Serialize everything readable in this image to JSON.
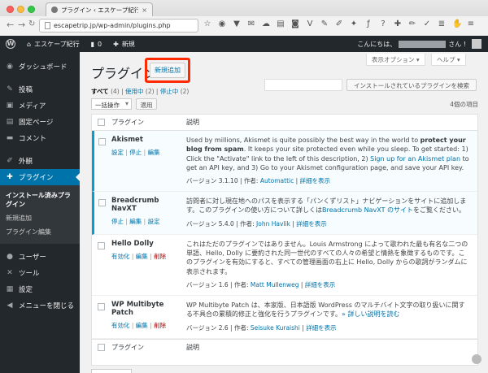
{
  "browser": {
    "tab_title": "プラグイン ‹ エスケープ紀行",
    "url": "escapetrip.jp/wp-admin/plugins.php"
  },
  "adminbar": {
    "site": "エスケープ紀行",
    "comments": "0",
    "new": "新規",
    "greeting": "こんにちは、",
    "greeting_suffix": "さん !"
  },
  "sidebar": {
    "items": [
      {
        "label": "ダッシュボード",
        "icon": "dashboard-icon"
      },
      {
        "label": "投稿",
        "icon": "pin-icon"
      },
      {
        "label": "メディア",
        "icon": "media-icon"
      },
      {
        "label": "固定ページ",
        "icon": "page-icon"
      },
      {
        "label": "コメント",
        "icon": "comment-icon"
      },
      {
        "label": "外観",
        "icon": "brush-icon"
      },
      {
        "label": "プラグイン",
        "icon": "plugin-icon"
      },
      {
        "label": "ユーザー",
        "icon": "user-icon"
      },
      {
        "label": "ツール",
        "icon": "wrench-icon"
      },
      {
        "label": "設定",
        "icon": "settings-icon"
      },
      {
        "label": "メニューを閉じる",
        "icon": "collapse-icon"
      }
    ],
    "submenu": [
      "インストール済みプラグイン",
      "新規追加",
      "プラグイン編集"
    ]
  },
  "main": {
    "screen_options": "表示オプション ▾",
    "help": "ヘルプ ▾",
    "title": "プラグイン",
    "add_new": "新規追加",
    "filters": {
      "all": "すべて",
      "all_count": "(4)",
      "active": "使用中",
      "active_count": "(2)",
      "inactive": "停止中",
      "inactive_count": "(2)"
    },
    "search_button": "インストールされているプラグインを検索",
    "bulk_action": "一括操作",
    "apply": "適用",
    "item_count": "4個の項目",
    "columns": {
      "plugin": "プラグイン",
      "description": "説明"
    }
  },
  "plugins": [
    {
      "name": "Akismet",
      "actions": [
        "設定",
        "停止",
        "編集"
      ],
      "desc_1": "Used by millions, Akismet is quite possibly the best way in the world to ",
      "desc_bold": "protect your blog from spam",
      "desc_2": ". It keeps your site protected even while you sleep. To get started: 1) Click the \"Activate\" link to the left of this description, 2) ",
      "desc_link": "Sign up for an Akismet plan",
      "desc_3": " to get an API key, and 3) Go to your Akismet configuration page, and save your API key.",
      "version": "バージョン 3.1.10",
      "author_label": " | 作者: ",
      "author": "Automattic",
      "details": "詳細を表示"
    },
    {
      "name": "Breadcrumb NavXT",
      "actions": [
        "停止",
        "編集",
        "設定"
      ],
      "desc_1": "訪問者に対し現在地へのパスを表示する「パンくずリスト」ナビゲーションをサイトに追加します。このプラグインの使い方について詳しくは",
      "desc_link": "Breadcrumb NavXT のサイト",
      "desc_2": "をご覧ください。",
      "version": "バージョン 5.4.0",
      "author_label": " | 作者: ",
      "author": "John Havlik",
      "details": "詳細を表示"
    },
    {
      "name": "Hello Dolly",
      "actions": [
        "有効化",
        "編集",
        "削除"
      ],
      "desc_1": "これはただのプラグインではありません。Louis Armstrong によって歌われた最も有名な二つの単語、Hello, Dolly に要約された同一世代のすべての人々の希望と情熱を象徴するものです。このプラグインを有効にすると、すべての管理画面の右上に Hello, Dolly からの歌詞がランダムに表示されます。",
      "version": "バージョン 1.6",
      "author_label": " | 作者: ",
      "author": "Matt Mullenweg",
      "details": "詳細を表示"
    },
    {
      "name": "WP Multibyte Patch",
      "actions": [
        "有効化",
        "編集",
        "削除"
      ],
      "desc_1": "WP Multibyte Patch は、本家版、日本語版 WordPress のマルチバイト文字の取り扱いに関する不具合の累積的修正と強化を行うプラグインです。",
      "desc_link": "» 詳しい説明を読む",
      "version": "バージョン 2.6",
      "author_label": " | 作者: ",
      "author": "Seisuke Kuraishi",
      "details": "詳細を表示"
    }
  ]
}
